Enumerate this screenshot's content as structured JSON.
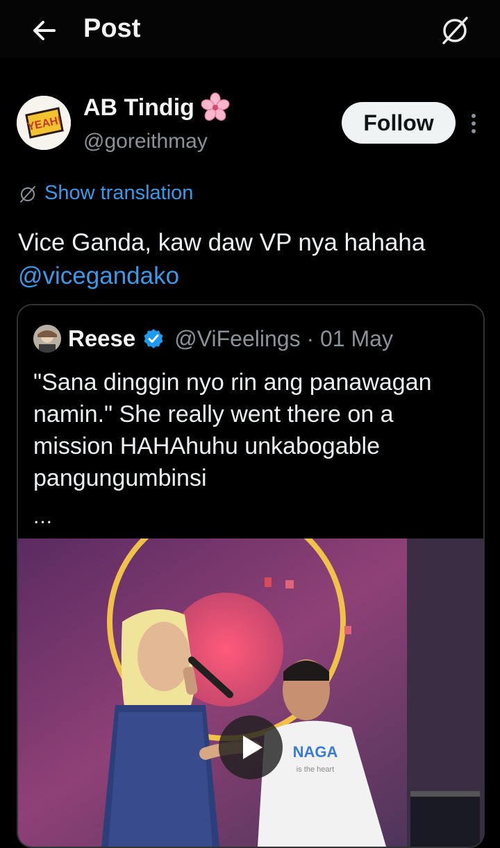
{
  "header": {
    "title": "Post",
    "back_icon": "arrow-left-icon",
    "translate_icon": "globe-strikethrough-icon"
  },
  "author": {
    "display_name": "AB Tindig",
    "emoji": "cherry-blossom",
    "handle": "@goreithmay",
    "avatar_text": "YEAH!",
    "follow_label": "Follow"
  },
  "translation": {
    "label": "Show translation"
  },
  "post": {
    "text": "Vice Ganda, kaw daw VP nya hahaha ",
    "mention": "@vicegandako"
  },
  "quote": {
    "name": "Reese",
    "verified": true,
    "handle": "@ViFeelings · 01 May",
    "text": "\"Sana dinggin nyo rin ang panawagan namin.\" She really went there on a mission HAHAhuhu unkabogable pangungumbinsi",
    "ellipsis": "...",
    "media": {
      "type": "video",
      "play_icon": "play-icon",
      "shirt_text": "NAGA",
      "shirt_subtext": "is the heart"
    }
  },
  "colors": {
    "background": "#000000",
    "accent": "#3a9ae8",
    "muted": "#8b9299",
    "verified": "#1d9bf0"
  }
}
